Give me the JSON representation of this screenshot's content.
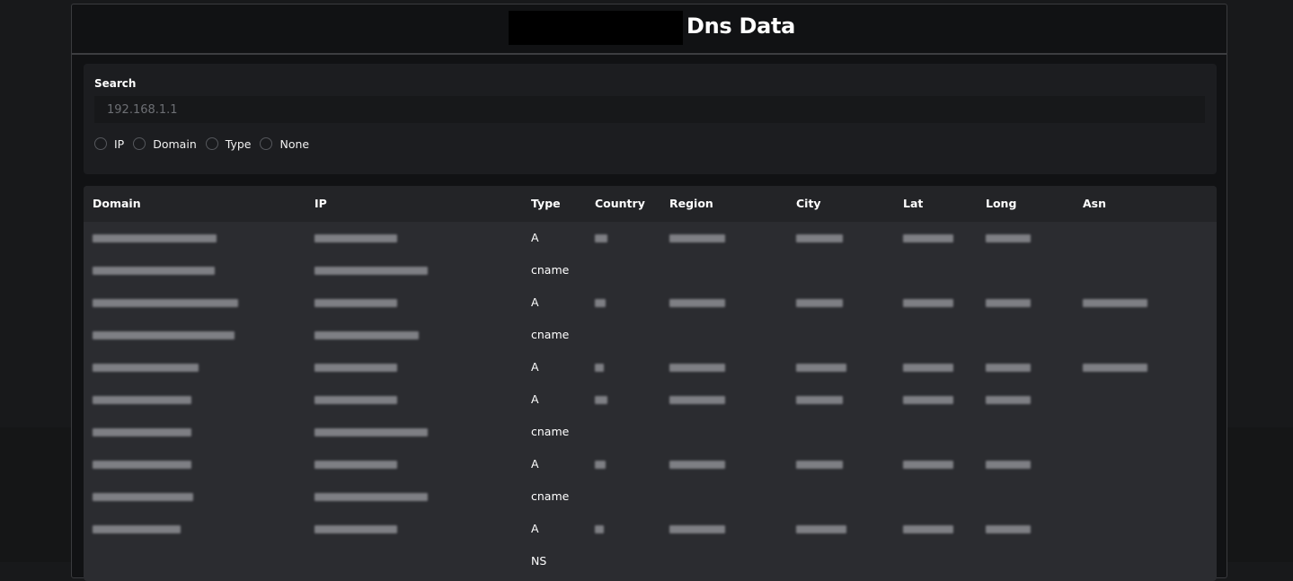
{
  "header": {
    "title": "Dns Data"
  },
  "search": {
    "label": "Search",
    "placeholder": "192.168.1.1",
    "value": "",
    "options": [
      "IP",
      "Domain",
      "Type",
      "None"
    ]
  },
  "table": {
    "columns": [
      "Domain",
      "IP",
      "Type",
      "Country",
      "Region",
      "City",
      "Lat",
      "Long",
      "Asn"
    ],
    "rows": [
      {
        "domain": "",
        "ip": "",
        "type": "A",
        "country": "",
        "region": "",
        "city": "",
        "lat": "",
        "long": "",
        "asn": ""
      },
      {
        "domain": "",
        "ip": "",
        "type": "cname",
        "country": "",
        "region": "",
        "city": "",
        "lat": "",
        "long": "",
        "asn": ""
      },
      {
        "domain": "",
        "ip": "",
        "type": "A",
        "country": "",
        "region": "",
        "city": "",
        "lat": "",
        "long": "",
        "asn": ""
      },
      {
        "domain": "",
        "ip": "",
        "type": "cname",
        "country": "",
        "region": "",
        "city": "",
        "lat": "",
        "long": "",
        "asn": ""
      },
      {
        "domain": "",
        "ip": "",
        "type": "A",
        "country": "",
        "region": "",
        "city": "",
        "lat": "",
        "long": "",
        "asn": ""
      },
      {
        "domain": "",
        "ip": "",
        "type": "A",
        "country": "",
        "region": "",
        "city": "",
        "lat": "",
        "long": "",
        "asn": ""
      },
      {
        "domain": "",
        "ip": "",
        "type": "cname",
        "country": "",
        "region": "",
        "city": "",
        "lat": "",
        "long": "",
        "asn": ""
      },
      {
        "domain": "",
        "ip": "",
        "type": "A",
        "country": "",
        "region": "",
        "city": "",
        "lat": "",
        "long": "",
        "asn": ""
      },
      {
        "domain": "",
        "ip": "",
        "type": "cname",
        "country": "",
        "region": "",
        "city": "",
        "lat": "",
        "long": "",
        "asn": ""
      },
      {
        "domain": "",
        "ip": "",
        "type": "A",
        "country": "",
        "region": "",
        "city": "",
        "lat": "",
        "long": "",
        "asn": ""
      },
      {
        "domain": "",
        "ip": "",
        "type": "NS",
        "country": "",
        "region": "",
        "city": "",
        "lat": "",
        "long": "",
        "asn": ""
      }
    ]
  }
}
